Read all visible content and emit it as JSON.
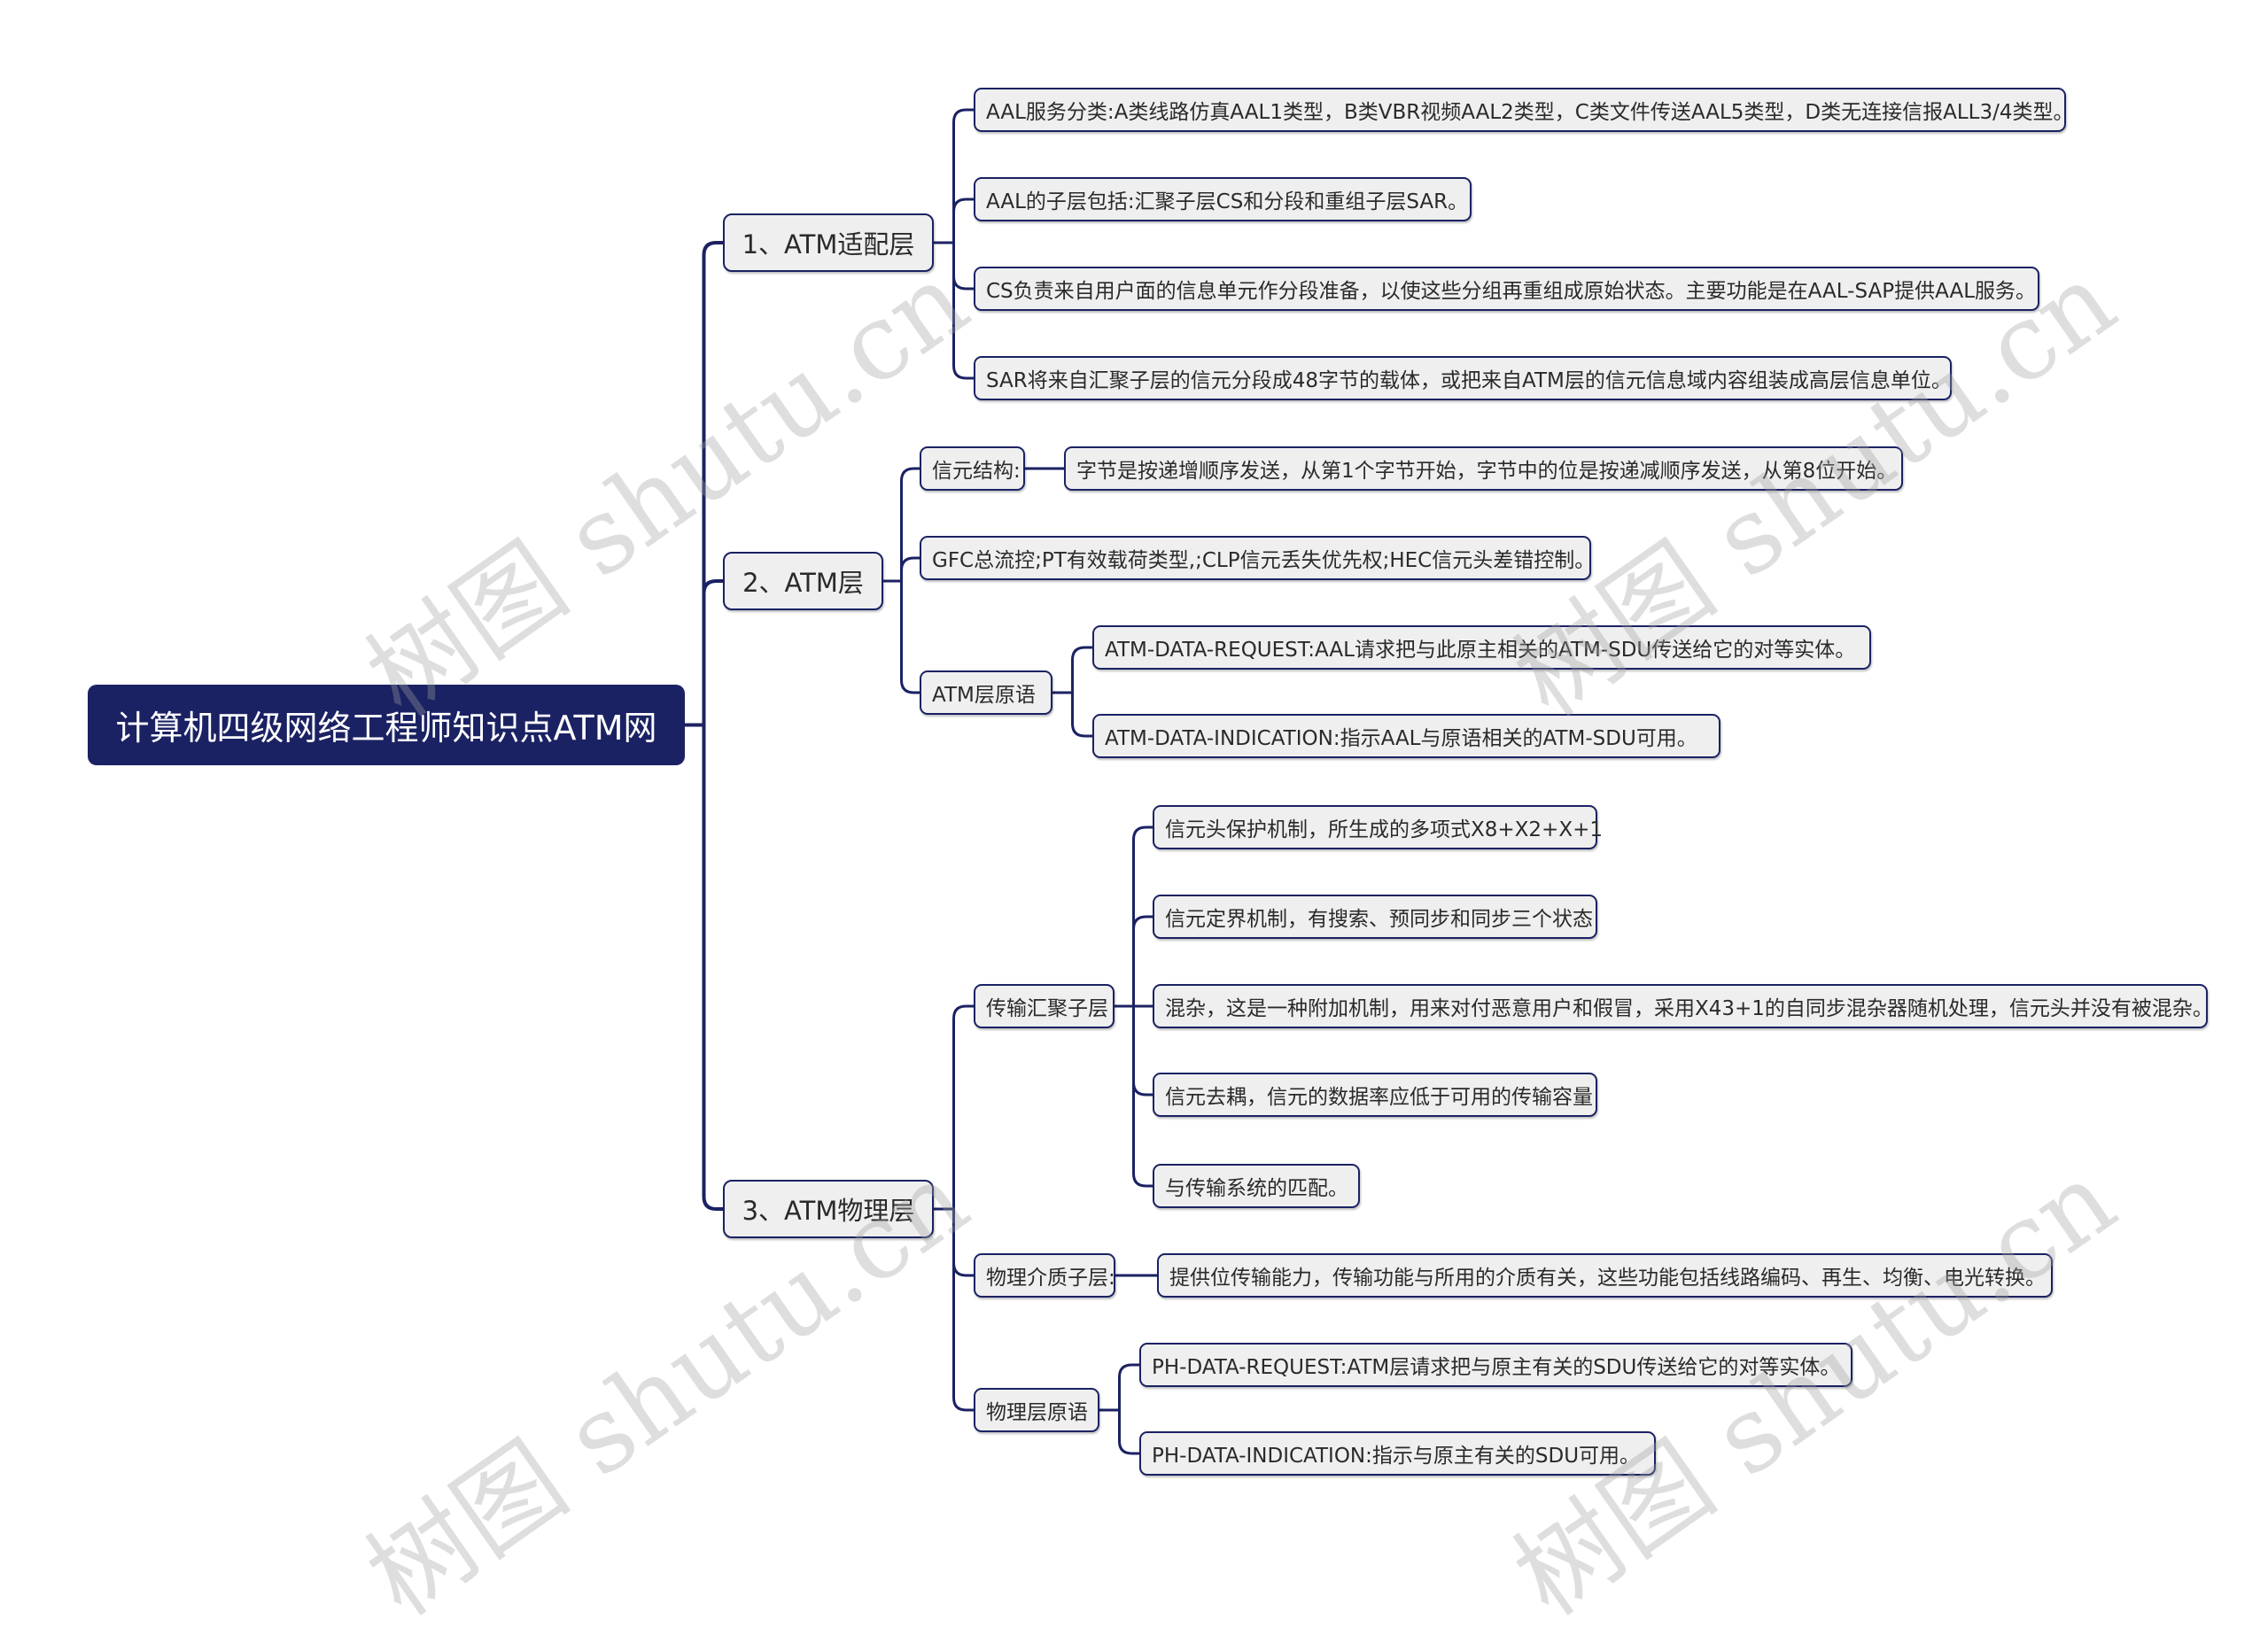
{
  "root": {
    "label": "计算机四级网络工程师知识点ATM网"
  },
  "branches": [
    {
      "label": "1、ATM适配层",
      "children": [
        {
          "label": "AAL服务分类:A类线路仿真AAL1类型，B类VBR视频AAL2类型，C类文件传送AAL5类型，D类无连接信报ALL3/4类型。"
        },
        {
          "label": "AAL的子层包括:汇聚子层CS和分段和重组子层SAR。"
        },
        {
          "label": "CS负责来自用户面的信息单元作分段准备，以使这些分组再重组成原始状态。主要功能是在AAL-SAP提供AAL服务。"
        },
        {
          "label": "SAR将来自汇聚子层的信元分段成48字节的载体，或把来自ATM层的信元信息域内容组装成高层信息单位。"
        }
      ]
    },
    {
      "label": "2、ATM层",
      "children": [
        {
          "label": "信元结构:",
          "children": [
            {
              "label": "字节是按递增顺序发送，从第1个字节开始，字节中的位是按递减顺序发送，从第8位开始。"
            }
          ]
        },
        {
          "label": "GFC总流控;PT有效载荷类型,;CLP信元丢失优先权;HEC信元头差错控制。"
        },
        {
          "label": "ATM层原语",
          "children": [
            {
              "label": "ATM-DATA-REQUEST:AAL请求把与此原主相关的ATM-SDU传送给它的对等实体。"
            },
            {
              "label": "ATM-DATA-INDICATION:指示AAL与原语相关的ATM-SDU可用。"
            }
          ]
        }
      ]
    },
    {
      "label": "3、ATM物理层",
      "children": [
        {
          "label": "传输汇聚子层",
          "children": [
            {
              "label": "信元头保护机制，所生成的多项式X8+X2+X+1"
            },
            {
              "label": "信元定界机制，有搜索、预同步和同步三个状态"
            },
            {
              "label": "混杂，这是一种附加机制，用来对付恶意用户和假冒，采用X43+1的自同步混杂器随机处理，信元头并没有被混杂。"
            },
            {
              "label": "信元去耦，信元的数据率应低于可用的传输容量"
            },
            {
              "label": "与传输系统的匹配。"
            }
          ]
        },
        {
          "label": "物理介质子层:",
          "children": [
            {
              "label": "提供位传输能力，传输功能与所用的介质有关，这些功能包括线路编码、再生、均衡、电光转换。"
            }
          ]
        },
        {
          "label": "物理层原语",
          "children": [
            {
              "label": "PH-DATA-REQUEST:ATM层请求把与原主有关的SDU传送给它的对等实体。"
            },
            {
              "label": "PH-DATA-INDICATION:指示与原主有关的SDU可用。"
            }
          ]
        }
      ]
    }
  ],
  "watermark": {
    "text": "树图 shutu.cn"
  },
  "colors": {
    "line": "#1b2263",
    "root_fill": "#1b2263",
    "node_fill": "#efefef"
  }
}
